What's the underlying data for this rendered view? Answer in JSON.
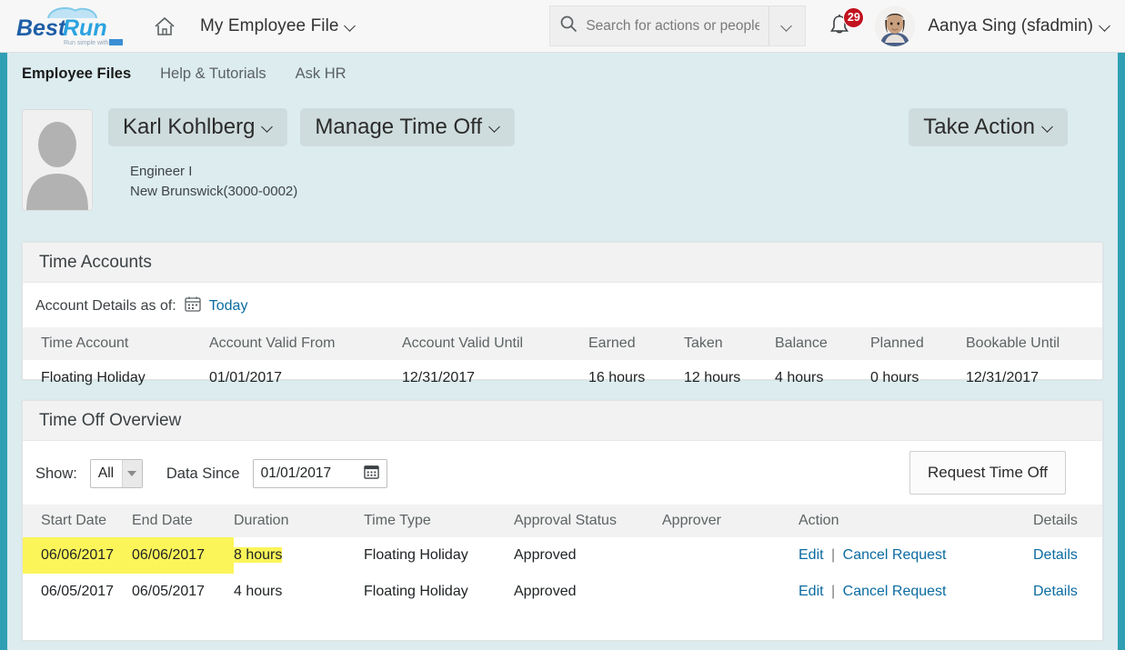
{
  "topbar": {
    "logo_main": "Best",
    "logo_accent": "Run",
    "logo_tagline": "Run simple with SAP",
    "home_icon": "home-icon",
    "menu_label": "My Employee File",
    "search_placeholder": "Search for actions or people",
    "search_value": "",
    "search_icon": "search-icon",
    "search_dropdown_icon": "chevron-down-icon",
    "bell_icon": "bell-icon",
    "notification_count": "29",
    "user_name": "Aanya Sing (sfadmin)",
    "user_chevron_icon": "chevron-down-icon"
  },
  "nav": {
    "tabs": [
      {
        "label": "Employee Files",
        "active": true
      },
      {
        "label": "Help & Tutorials",
        "active": false
      },
      {
        "label": "Ask HR",
        "active": false
      }
    ]
  },
  "employee": {
    "photo_icon": "user-silhouette-icon",
    "name": "Karl Kohlberg",
    "manage_menu": "Manage Time Off",
    "title": "Engineer I",
    "location": "New Brunswick(3000-0002)",
    "take_action": "Take Action"
  },
  "time_accounts": {
    "card_title": "Time Accounts",
    "as_of_label": "Account Details as of:",
    "as_of_icon": "calendar-icon",
    "as_of_value": "Today",
    "columns": [
      "Time Account",
      "Account Valid From",
      "Account Valid Until",
      "Earned",
      "Taken",
      "Balance",
      "Planned",
      "Bookable Until"
    ],
    "rows": [
      {
        "time_account": "Floating Holiday",
        "valid_from": "01/01/2017",
        "valid_until": "12/31/2017",
        "earned": "16 hours",
        "taken": "12 hours",
        "balance": "4 hours",
        "planned": "0 hours",
        "bookable_until": "12/31/2017"
      }
    ]
  },
  "time_off_overview": {
    "card_title": "Time Off Overview",
    "show_label": "Show:",
    "show_value": "All",
    "show_options": [
      "All"
    ],
    "data_since_label": "Data Since",
    "data_since_value": "01/01/2017",
    "data_since_icon": "calendar-icon",
    "request_button": "Request Time Off",
    "columns": [
      "Start Date",
      "End Date",
      "Duration",
      "Time Type",
      "Approval Status",
      "Approver",
      "Action",
      "Details"
    ],
    "rows": [
      {
        "start_date": "06/06/2017",
        "end_date": "06/06/2017",
        "duration": "8 hours",
        "time_type": "Floating Holiday",
        "approval_status": "Approved",
        "approver": "",
        "action_edit": "Edit",
        "action_separator": "|",
        "action_cancel": "Cancel Request",
        "details": "Details",
        "highlighted": true
      },
      {
        "start_date": "06/05/2017",
        "end_date": "06/05/2017",
        "duration": "4 hours",
        "time_type": "Floating Holiday",
        "approval_status": "Approved",
        "approver": "",
        "action_edit": "Edit",
        "action_separator": "|",
        "action_cancel": "Cancel Request",
        "details": "Details",
        "highlighted": false
      }
    ]
  },
  "colors": {
    "accent_teal": "#2f9fb3",
    "link_blue": "#0b6ba1",
    "badge_red": "#c1121f",
    "highlight_yellow": "#fbf55a",
    "page_bg": "#dcecef"
  }
}
